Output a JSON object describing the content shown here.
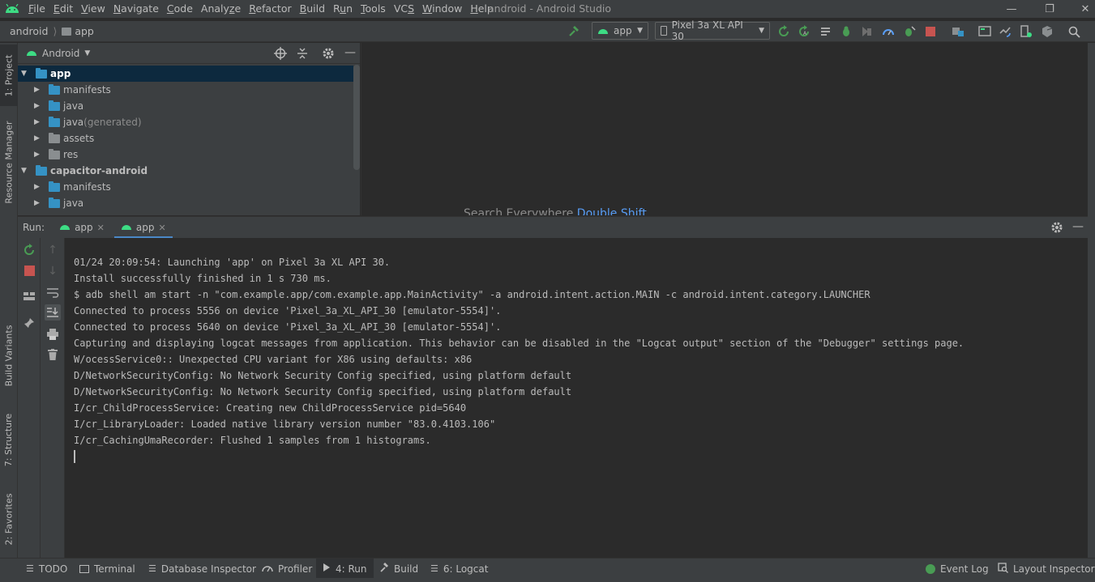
{
  "menu": {
    "items": [
      {
        "pre": "",
        "u": "F",
        "post": "ile"
      },
      {
        "pre": "",
        "u": "E",
        "post": "dit"
      },
      {
        "pre": "",
        "u": "V",
        "post": "iew"
      },
      {
        "pre": "",
        "u": "N",
        "post": "avigate"
      },
      {
        "pre": "",
        "u": "C",
        "post": "ode"
      },
      {
        "pre": "Analy",
        "u": "z",
        "post": "e"
      },
      {
        "pre": "",
        "u": "R",
        "post": "efactor"
      },
      {
        "pre": "",
        "u": "B",
        "post": "uild"
      },
      {
        "pre": "R",
        "u": "u",
        "post": "n"
      },
      {
        "pre": "",
        "u": "T",
        "post": "ools"
      },
      {
        "pre": "VC",
        "u": "S",
        "post": ""
      },
      {
        "pre": "",
        "u": "W",
        "post": "indow"
      },
      {
        "pre": "",
        "u": "H",
        "post": "elp"
      }
    ],
    "window_title": "android - Android Studio"
  },
  "navbar": {
    "crumb_root": "android",
    "crumb_module": "app",
    "run_config": "app",
    "device": "Pixel 3a XL API 30"
  },
  "left_strip": {
    "project": "1: Project",
    "resource_manager": "Resource Manager",
    "build_variants": "Build Variants",
    "structure": "7: Structure",
    "favorites": "2: Favorites"
  },
  "project": {
    "view_mode": "Android",
    "tree": [
      {
        "label": "app",
        "suffix": "",
        "level": 0,
        "expanded": true,
        "selected": true,
        "bold": true
      },
      {
        "label": "manifests",
        "suffix": "",
        "level": 1,
        "expanded": false
      },
      {
        "label": "java",
        "suffix": "",
        "level": 1,
        "expanded": false
      },
      {
        "label": "java",
        "suffix": " (generated)",
        "level": 1,
        "expanded": false
      },
      {
        "label": "assets",
        "suffix": "",
        "level": 1,
        "expanded": false,
        "gray": true
      },
      {
        "label": "res",
        "suffix": "",
        "level": 1,
        "expanded": false,
        "gray": true
      },
      {
        "label": "capacitor-android",
        "suffix": "",
        "level": 0,
        "expanded": true,
        "bold": true
      },
      {
        "label": "manifests",
        "suffix": "",
        "level": 1,
        "expanded": false
      },
      {
        "label": "java",
        "suffix": "",
        "level": 1,
        "expanded": false
      }
    ]
  },
  "editor": {
    "hint_text": "Search Everywhere",
    "hint_shortcut": "Double Shift"
  },
  "run": {
    "label": "Run:",
    "tabs": [
      "app",
      "app"
    ],
    "output": [
      "01/24 20:09:54: Launching 'app' on Pixel 3a XL API 30.",
      "Install successfully finished in 1 s 730 ms.",
      "$ adb shell am start -n \"com.example.app/com.example.app.MainActivity\" -a android.intent.action.MAIN -c android.intent.category.LAUNCHER",
      "Connected to process 5556 on device 'Pixel_3a_XL_API_30 [emulator-5554]'.",
      "Connected to process 5640 on device 'Pixel_3a_XL_API_30 [emulator-5554]'.",
      "Capturing and displaying logcat messages from application. This behavior can be disabled in the \"Logcat output\" section of the \"Debugger\" settings page.",
      "W/ocessService0:: Unexpected CPU variant for X86 using defaults: x86",
      "D/NetworkSecurityConfig: No Network Security Config specified, using platform default",
      "D/NetworkSecurityConfig: No Network Security Config specified, using platform default",
      "I/cr_ChildProcessService: Creating new ChildProcessService pid=5640",
      "I/cr_LibraryLoader: Loaded native library version number \"83.0.4103.106\"",
      "I/cr_CachingUmaRecorder: Flushed 1 samples from 1 histograms."
    ]
  },
  "statusbar": {
    "todo": "TODO",
    "terminal": "Terminal",
    "database_inspector": "Database Inspector",
    "profiler": "Profiler",
    "run": "4: Run",
    "build": "Build",
    "logcat": "6: Logcat",
    "event_log": "Event Log",
    "layout_inspector": "Layout Inspector"
  },
  "colors": {
    "android_green": "#3ddc84",
    "folder_blue": "#3592c4",
    "accent_blue": "#4a88c7",
    "stop_red": "#c75450"
  }
}
